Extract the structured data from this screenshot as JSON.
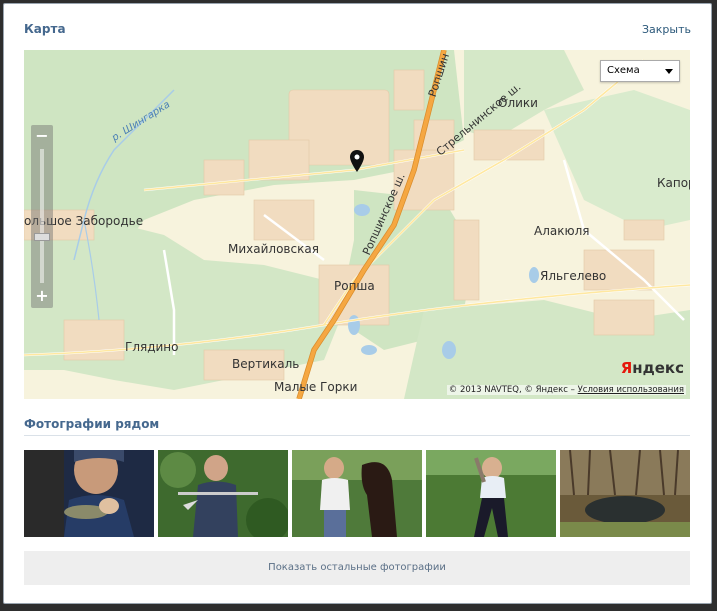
{
  "modal": {
    "title": "Карта",
    "close_label": "Закрыть"
  },
  "map": {
    "type_select": {
      "selected": "Схема"
    },
    "labels": {
      "bolshoe_zaborodye": "ольшое Забородье",
      "mikhailovskaya": "Михайловская",
      "ropsha": "Ропша",
      "glyadino": "Глядино",
      "vertikal": "Вертикаль",
      "malye_gorki": "Малые Горки",
      "oliki": "Олики",
      "alakyulya": "Алакюля",
      "yalgelevo": "Яльгелево",
      "kapor": "Капор",
      "river": "р. Шингарка",
      "road1": "Ропшинское ш.",
      "road2": "Стрельнинское ш.",
      "road3": "Ропшин"
    },
    "logo": {
      "y": "Я",
      "rest": "ндекс"
    },
    "attribution": {
      "text": "© 2013 NAVTEQ, © Яндекс – ",
      "terms": "Условия использования"
    },
    "zoom": {
      "plus": "+",
      "minus": "−"
    }
  },
  "photos_section": {
    "title": "Фотографии рядом",
    "show_more_label": "Показать остальные фотографии"
  },
  "icons": {
    "pin": "map-pin-icon",
    "dropdown": "chevron-down-icon"
  },
  "colors": {
    "accent": "#45688e",
    "link": "#2b587a",
    "map_bg": "#f7f3dd",
    "forest": "#cfe5c2",
    "road_major": "#f5a742",
    "road_minor": "#ffe8a0"
  }
}
